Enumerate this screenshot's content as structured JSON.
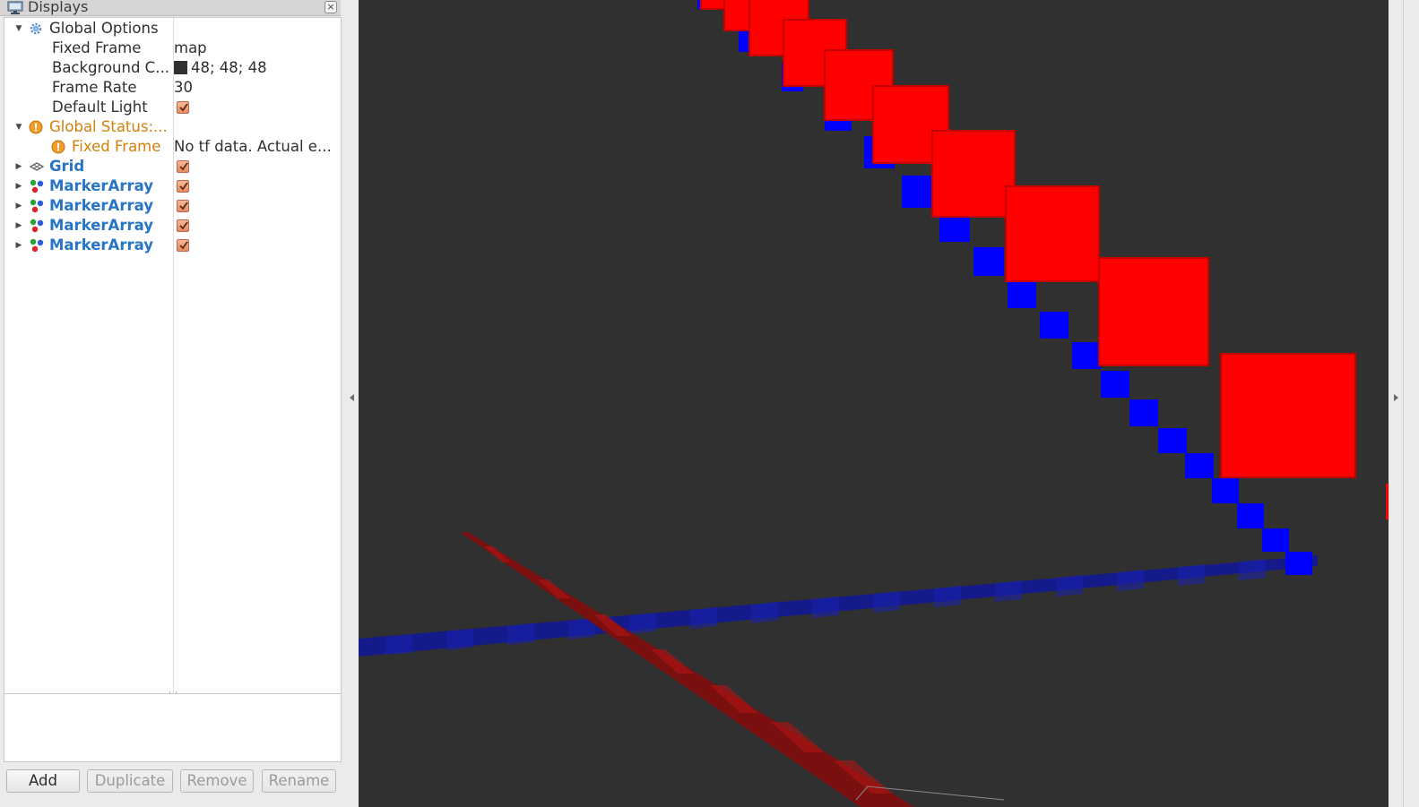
{
  "panel": {
    "title": "Displays",
    "close_label": "×"
  },
  "tree": {
    "global_options": {
      "label": "Global Options",
      "fixed_frame": {
        "label": "Fixed Frame",
        "value": "map"
      },
      "background_color": {
        "label": "Background C...",
        "value": "48; 48; 48",
        "swatch": "#303030"
      },
      "frame_rate": {
        "label": "Frame Rate",
        "value": "30"
      },
      "default_light": {
        "label": "Default Light",
        "checked": true
      }
    },
    "global_status": {
      "label": "Global Status:...",
      "fixed_frame": {
        "label": "Fixed Frame",
        "value": "No tf data.  Actual e..."
      }
    },
    "displays": [
      {
        "label": "Grid",
        "icon": "grid-icon",
        "checked": true
      },
      {
        "label": "MarkerArray",
        "icon": "marker-array-icon",
        "checked": true
      },
      {
        "label": "MarkerArray",
        "icon": "marker-array-icon",
        "checked": true
      },
      {
        "label": "MarkerArray",
        "icon": "marker-array-icon",
        "checked": true
      },
      {
        "label": "MarkerArray",
        "icon": "marker-array-icon",
        "checked": true
      }
    ]
  },
  "buttons": {
    "add": "Add",
    "duplicate": "Duplicate",
    "remove": "Remove",
    "rename": "Rename"
  },
  "colors": {
    "background": "#303030",
    "red_marker": "#ff0000",
    "blue_marker": "#0000ff",
    "status_orange": "#d0810b",
    "display_blue": "#2874c5"
  }
}
